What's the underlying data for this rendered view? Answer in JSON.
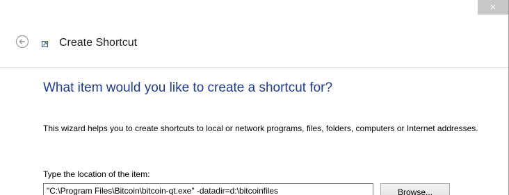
{
  "window": {
    "close_glyph": "×",
    "title": "Create Shortcut"
  },
  "icons": {
    "back": "back-arrow-icon",
    "shortcut": "shortcut-icon",
    "close": "close-icon"
  },
  "content": {
    "heading": "What item would you like to create a shortcut for?",
    "description": "This wizard helps you to create shortcuts to local or network programs, files, folders, computers or Internet addresses.",
    "location_label": "Type the location of the item:",
    "location_value": "\"C:\\Program Files\\Bitcoin\\bitcoin-qt.exe\" -datadir=d:\\bitcoinfiles",
    "browse_label": "Browse..."
  },
  "colors": {
    "heading": "#1e3c8c",
    "close_button_bg": "#c7c7c7"
  }
}
